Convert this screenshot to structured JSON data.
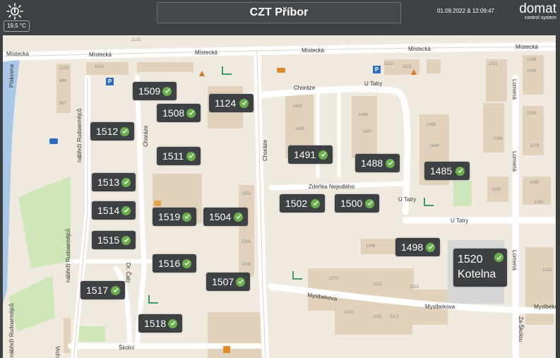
{
  "header": {
    "title": "CZT Příbor",
    "temperature": "19,5 °C",
    "datetime": "01.09.2022 & 12:09:47",
    "brand": "domat",
    "brand_sub": "control system",
    "weather_icon": "sun-thermometer-icon"
  },
  "colors": {
    "header_bg": "#3e4245",
    "tile_bg": "#3d4144",
    "status_ok": "#6ab04c",
    "map_bg": "#efe9df",
    "building": "#e3d2bb",
    "park": "#cfe6b8",
    "river": "#a9c8e8"
  },
  "status_icon": "ok-check-icon",
  "streets": {
    "mistecka1": "Místecká",
    "mistecka2": "Místecká",
    "mistecka3": "Místecká",
    "mistecka4": "Místecká",
    "mistecka5": "Místecká",
    "mistecka6": "Místecká",
    "chorazeTop": "Choráze",
    "uTatryTop": "U Tatry",
    "uTatryRight": "U Tatry",
    "uTatryLow": "U Tatry",
    "nabrezi1": "nábřeží Rudoarmějců",
    "nabrezi2": "nábřeží Rudoarmějců",
    "nabrezi3": "nábřeží Rudoarmějců",
    "piskovna": "Pískovna",
    "choraze2": "Choráze",
    "choraze3": "Choráze",
    "zdenka": "Zdeňka Nejedlého",
    "lomena1": "Lomená",
    "lomena2": "Lomená",
    "lomena3": "Lomená",
    "myslbekova1": "Myslbekova",
    "myslbekova2": "Myslbekova",
    "myslbekova3": "Myslbekova",
    "skolni": "Školní",
    "caly": "Dr. Čalý",
    "zaSkolou": "Za Školou",
    "vrch": "Vrch"
  },
  "buildings": [
    "1126",
    "868",
    "867",
    "1143",
    "1123",
    "1113",
    "1112",
    "1110",
    "1098",
    "1099",
    "1489",
    "1490",
    "1486",
    "1487",
    "1483",
    "1484",
    "1094",
    "1095",
    "1079",
    "1128",
    "1085",
    "1090",
    "1502",
    "1503",
    "1505",
    "1506",
    "1496",
    "1570",
    "1021",
    "1022",
    "1022",
    "1031",
    "1113",
    "1019"
  ],
  "substations": [
    {
      "label": "1509"
    },
    {
      "label": "1508"
    },
    {
      "label": "1124"
    },
    {
      "label": "1512"
    },
    {
      "label": "1511"
    },
    {
      "label": "1491"
    },
    {
      "label": "1488"
    },
    {
      "label": "1485"
    },
    {
      "label": "1513"
    },
    {
      "label": "1502"
    },
    {
      "label": "1500"
    },
    {
      "label": "1514"
    },
    {
      "label": "1519"
    },
    {
      "label": "1504"
    },
    {
      "label": "1515"
    },
    {
      "label": "1498"
    },
    {
      "label": "1516"
    },
    {
      "label": "1507"
    },
    {
      "label": "1517"
    },
    {
      "label": "1518"
    }
  ],
  "boiler": {
    "line1": "1520",
    "line2": "Kotelna"
  }
}
